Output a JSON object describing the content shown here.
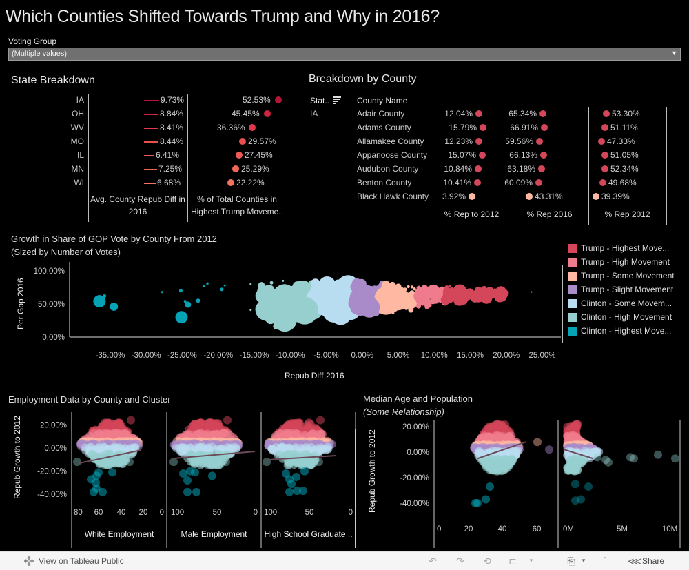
{
  "title": "Which Counties Shifted Towards Trump and Why in 2016?",
  "filter": {
    "label": "Voting Group",
    "value": "(Multiple values)"
  },
  "colors": {
    "trump_highest": "#d4465a",
    "trump_high": "#f07b8c",
    "trump_some": "#ffb8a2",
    "trump_slight": "#a98bc9",
    "clinton_some": "#b9ddf0",
    "clinton_high": "#97cfcf",
    "clinton_highest": "#06a3b5",
    "state_bar_dark": "#c0203e",
    "state_bar_light": "#f47a6a"
  },
  "state_breakdown": {
    "title": "State Breakdown",
    "col1_header_line1": "Avg. County Repub Diff in",
    "col1_header_line2": "2016",
    "col2_header_line1": "% of Total Counties in",
    "col2_header_line2": "Highest Trump Moveme..",
    "rows": [
      {
        "state": "IA",
        "avg_diff": "9.73%",
        "avg_diff_value": 9.73,
        "pct_highest": "52.53%",
        "pct_value": 52.53,
        "color": "#b3163a"
      },
      {
        "state": "OH",
        "avg_diff": "8.84%",
        "avg_diff_value": 8.84,
        "pct_highest": "45.45%",
        "pct_value": 45.45,
        "color": "#cf2540"
      },
      {
        "state": "WV",
        "avg_diff": "8.41%",
        "avg_diff_value": 8.41,
        "pct_highest": "36.36%",
        "pct_value": 36.36,
        "color": "#e0384a"
      },
      {
        "state": "MO",
        "avg_diff": "8.44%",
        "avg_diff_value": 8.44,
        "pct_highest": "29.57%",
        "pct_value": 29.57,
        "color": "#ea4f50"
      },
      {
        "state": "IL",
        "avg_diff": "6.41%",
        "avg_diff_value": 6.41,
        "pct_highest": "27.45%",
        "pct_value": 27.45,
        "color": "#ee5a55"
      },
      {
        "state": "MN",
        "avg_diff": "7.25%",
        "avg_diff_value": 7.25,
        "pct_highest": "25.29%",
        "pct_value": 25.29,
        "color": "#f16659"
      },
      {
        "state": "WI",
        "avg_diff": "6.68%",
        "avg_diff_value": 6.68,
        "pct_highest": "22.22%",
        "pct_value": 22.22,
        "color": "#f3735f"
      }
    ]
  },
  "county_breakdown": {
    "title": "Breakdown by County",
    "state_header": "Stat..",
    "county_header": "County Name",
    "state_value": "IA",
    "col_headers": [
      "% Rep to 2012",
      "% Rep 2016",
      "% Rep 2012"
    ],
    "rows": [
      {
        "county": "Adair County",
        "rep_to_2012": "12.04%",
        "rep_2016": "65.34%",
        "rep_2012": "53.30%",
        "color": "#d4465a"
      },
      {
        "county": "Adams County",
        "rep_to_2012": "15.79%",
        "rep_2016": "66.91%",
        "rep_2012": "51.11%",
        "color": "#d4465a"
      },
      {
        "county": "Allamakee County",
        "rep_to_2012": "12.23%",
        "rep_2016": "59.56%",
        "rep_2012": "47.33%",
        "color": "#d4465a"
      },
      {
        "county": "Appanoose County",
        "rep_to_2012": "15.07%",
        "rep_2016": "66.13%",
        "rep_2012": "51.05%",
        "color": "#d4465a"
      },
      {
        "county": "Audubon County",
        "rep_to_2012": "10.84%",
        "rep_2016": "63.18%",
        "rep_2012": "52.34%",
        "color": "#d4465a"
      },
      {
        "county": "Benton County",
        "rep_to_2012": "10.41%",
        "rep_2016": "60.09%",
        "rep_2012": "49.68%",
        "color": "#d4465a"
      },
      {
        "county": "Black Hawk County",
        "rep_to_2012": "3.92%",
        "rep_2016": "43.31%",
        "rep_2012": "39.39%",
        "color": "#ffb8a2"
      }
    ]
  },
  "growth_chart": {
    "title_line1": "Growth in Share of GOP Vote by County From 2012",
    "title_line2": "(Sized by Number of Votes)",
    "ylabel": "Per Gop 2016",
    "xlabel": "Repub Diff 2016",
    "yticks": [
      "100.00%",
      "50.00%",
      "0.00%"
    ],
    "xticks": [
      "-35.00%",
      "-30.00%",
      "-25.00%",
      "-20.00%",
      "-15.00%",
      "-10.00%",
      "-5.00%",
      "0.00%",
      "5.00%",
      "10.00%",
      "15.00%",
      "20.00%",
      "25.00%"
    ]
  },
  "legend": [
    {
      "label": "Trump - Highest Move...",
      "color": "#d4465a"
    },
    {
      "label": "Trump - High Movement",
      "color": "#f07b8c"
    },
    {
      "label": "Trump - Some Movement",
      "color": "#ffb8a2"
    },
    {
      "label": "Trump - Slight Movement",
      "color": "#a98bc9"
    },
    {
      "label": "Clinton - Some Movem...",
      "color": "#b9ddf0"
    },
    {
      "label": "Clinton - High Movement",
      "color": "#97cfcf"
    },
    {
      "label": "Clinton - Highest Move...",
      "color": "#06a3b5"
    }
  ],
  "employment_chart": {
    "title": "Employment Data by County and Cluster",
    "ylabel": "Repub Growth to 2012",
    "yticks": [
      "20.00%",
      "0.00%",
      "-20.00%",
      "-40.00%"
    ],
    "panels": [
      {
        "label": "White Employment",
        "xticks": [
          "80",
          "60",
          "40",
          "20",
          "0"
        ]
      },
      {
        "label": "Male Employment",
        "xticks": [
          "100",
          "50",
          "0"
        ]
      },
      {
        "label": "High School Graduate ..",
        "xticks": [
          "100",
          "50",
          "0"
        ]
      }
    ]
  },
  "age_chart": {
    "title": "Median Age and Population",
    "subtitle": "(Some Relationship)",
    "ylabel": "Repub Growth to 2012",
    "yticks": [
      "20.00%",
      "0.00%",
      "-20.00%",
      "-40.00%"
    ],
    "panels": [
      {
        "xticks": [
          "0",
          "20",
          "40",
          "60"
        ]
      },
      {
        "xticks": [
          "0M",
          "5M",
          "10M"
        ]
      }
    ]
  },
  "footer": {
    "view_label": "View on Tableau Public",
    "share_label": "Share"
  }
}
